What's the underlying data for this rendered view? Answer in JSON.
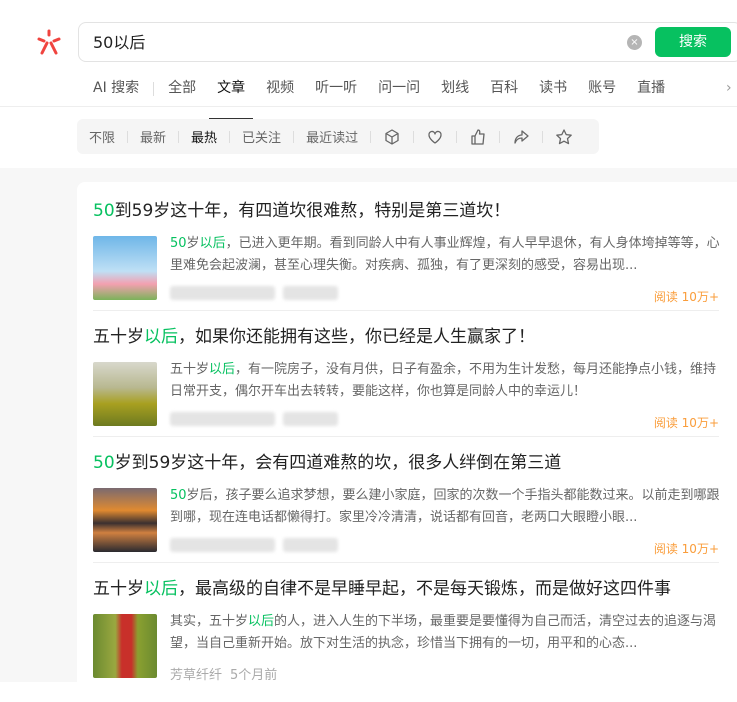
{
  "search": {
    "query": "50以后",
    "button": "搜索",
    "clear_icon": "close-circle-icon"
  },
  "tabs": [
    "AI 搜索",
    "全部",
    "文章",
    "视频",
    "听一听",
    "问一问",
    "划线",
    "百科",
    "读书",
    "账号",
    "直播"
  ],
  "active_tab": "文章",
  "filters": [
    "不限",
    "最新",
    "最热",
    "已关注",
    "最近读过"
  ],
  "active_filter": "最热",
  "filter_icons": [
    "cube-icon",
    "heart-icon",
    "thumbs-up-icon",
    "share-icon",
    "star-icon"
  ],
  "colors": {
    "accent": "#07c160",
    "read_count": "#fa9d3b",
    "logo": "#f0443f"
  },
  "results": [
    {
      "title": [
        {
          "t": "50",
          "h": true
        },
        {
          "t": "到59岁这十年，有四道坎很难熬，特别是第三道坎！",
          "h": false
        }
      ],
      "desc": [
        {
          "t": "50",
          "h": true
        },
        {
          "t": "岁",
          "h": false
        },
        {
          "t": "以后",
          "h": true
        },
        {
          "t": "，已进入更年期。看到同龄人中有人事业辉煌，有人早早退休，有人身体垮掉等等，心里难免会起波澜，甚至心理失衡。对疾病、孤独，有了更深刻的感受，容易出现...",
          "h": false
        }
      ],
      "reads": "阅读 10万+",
      "source": "",
      "time": ""
    },
    {
      "title": [
        {
          "t": "五十岁",
          "h": false
        },
        {
          "t": "以后",
          "h": true
        },
        {
          "t": "，如果你还能拥有这些，你已经是人生赢家了！",
          "h": false
        }
      ],
      "desc": [
        {
          "t": "五十岁",
          "h": false
        },
        {
          "t": "以后",
          "h": true
        },
        {
          "t": "，有一院房子，没有月供，日子有盈余，不用为生计发愁，每月还能挣点小钱，维持日常开支，偶尔开车出去转转，要能这样，你也算是同龄人中的幸运儿！",
          "h": false
        }
      ],
      "reads": "阅读 10万+",
      "source": "",
      "time": ""
    },
    {
      "title": [
        {
          "t": "50",
          "h": true
        },
        {
          "t": "岁到59岁这十年，会有四道难熬的坎，很多人绊倒在第三道",
          "h": false
        }
      ],
      "desc": [
        {
          "t": "50",
          "h": true
        },
        {
          "t": "岁后，孩子要么追求梦想，要么建小家庭，回家的次数一个手指头都能数过来。以前走到哪跟到哪，现在连电话都懒得打。家里冷冷清清，说话都有回音，老两口大眼瞪小眼...",
          "h": false
        }
      ],
      "reads": "阅读 10万+",
      "source": "",
      "time": ""
    },
    {
      "title": [
        {
          "t": "五十岁",
          "h": false
        },
        {
          "t": "以后",
          "h": true
        },
        {
          "t": "，最高级的自律不是早睡早起，不是每天锻炼，而是做好这四件事",
          "h": false
        }
      ],
      "desc": [
        {
          "t": "其实，五十岁",
          "h": false
        },
        {
          "t": "以后",
          "h": true
        },
        {
          "t": "的人，进入人生的下半场，最重要是要懂得为自己而活，清空过去的追逐与渴望，当自己重新开始。放下对生活的执念，珍惜当下拥有的一切，用平和的心态...",
          "h": false
        }
      ],
      "reads": "",
      "source": "芳草纤纤",
      "time": "5个月前"
    }
  ]
}
